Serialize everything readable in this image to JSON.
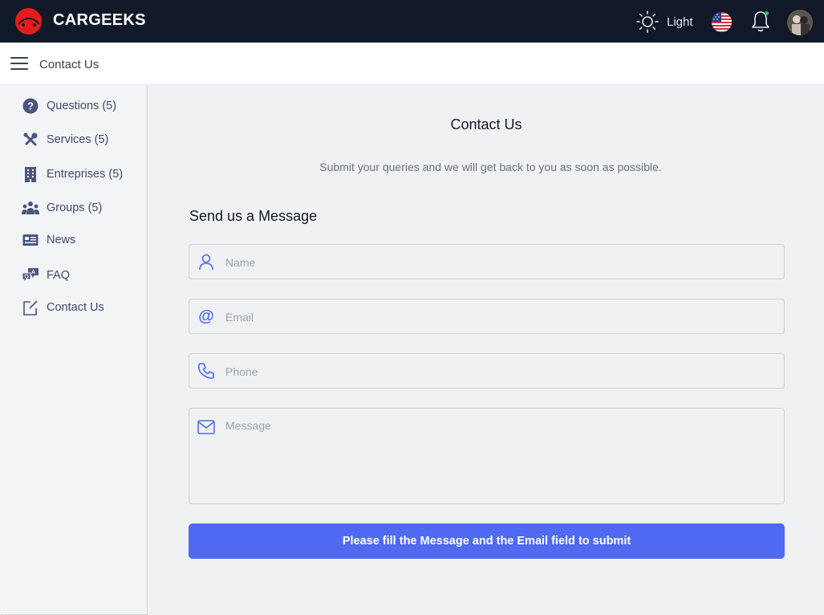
{
  "brand": {
    "name": "CARGEEKS",
    "logo_icon": "car-logo-icon",
    "logo_color": "#e11d1d"
  },
  "topbar": {
    "theme_label": "Light",
    "theme_icon": "sun-icon",
    "language_icon": "us-flag-icon",
    "notification_icon": "bell-icon",
    "notification_dot_color": "#22c55e",
    "avatar_icon": "user-avatar"
  },
  "subheader": {
    "title": "Contact Us",
    "menu_icon": "hamburger-icon"
  },
  "sidebar": {
    "items": [
      {
        "label": "Questions (5)",
        "icon": "question-circle-icon"
      },
      {
        "label": "Services (5)",
        "icon": "tools-icon"
      },
      {
        "label": "Entreprises (5)",
        "icon": "building-icon"
      },
      {
        "label": "Groups (5)",
        "icon": "users-group-icon"
      },
      {
        "label": "News",
        "icon": "newspaper-icon"
      },
      {
        "label": "FAQ",
        "icon": "faq-chat-icon"
      },
      {
        "label": "Contact Us",
        "icon": "edit-contact-icon"
      }
    ]
  },
  "main": {
    "title": "Contact Us",
    "subtitle": "Submit your queries and we will get back to you as soon as possible.",
    "section_title": "Send us a Message",
    "form": {
      "name_placeholder": "Name",
      "email_placeholder": "Email",
      "phone_placeholder": "Phone",
      "message_placeholder": "Message",
      "submit_label": "Please fill the Message and the Email field to submit"
    },
    "accent_color": "#4f6af0"
  }
}
